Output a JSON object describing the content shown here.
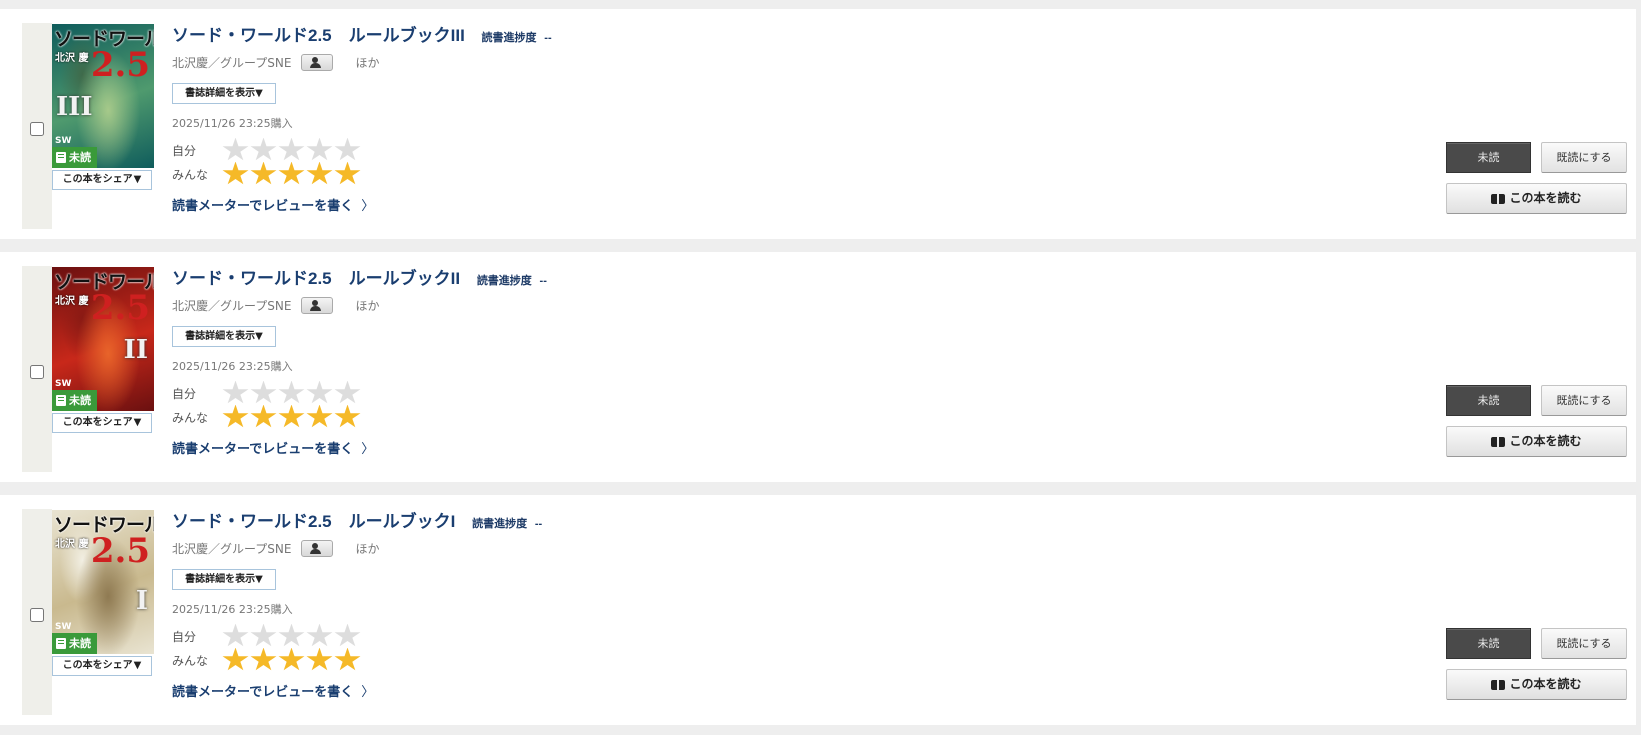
{
  "books": [
    {
      "title": "ソード・ワールド2.5　ルールブックIII",
      "progress_label": "読書進捗度",
      "progress_value": "--",
      "author": "北沢慶／グループSNE",
      "author_others": "ほか",
      "detail_button": "書誌詳細を表示▼",
      "purchase_date": "2025/11/26 23:25購入",
      "rating_mine_label": "自分",
      "rating_all_label": "みんな",
      "rating_mine": 0,
      "rating_all": 5,
      "review_link": "読書メーターでレビューを書く",
      "review_chevron": "〉",
      "status_button": "未読",
      "mark_read_button": "既読にする",
      "read_button": "この本を読む",
      "share_button": "この本をシェア",
      "share_caret": "▼",
      "cover": {
        "title": "ソードワールド",
        "author": "北沢 慶",
        "number": "2.5",
        "volume": "III",
        "logo": "SW",
        "badge": "未読",
        "art_colors": [
          "#0f5c5c",
          "#4f9a6e",
          "#a6c98a",
          "#3f6a4a"
        ]
      }
    },
    {
      "title": "ソード・ワールド2.5　ルールブックII",
      "progress_label": "読書進捗度",
      "progress_value": "--",
      "author": "北沢慶／グループSNE",
      "author_others": "ほか",
      "detail_button": "書誌詳細を表示▼",
      "purchase_date": "2025/11/26 23:25購入",
      "rating_mine_label": "自分",
      "rating_all_label": "みんな",
      "rating_mine": 0,
      "rating_all": 5,
      "review_link": "読書メーターでレビューを書く",
      "review_chevron": "〉",
      "status_button": "未読",
      "mark_read_button": "既読にする",
      "read_button": "この本を読む",
      "share_button": "この本をシェア",
      "share_caret": "▼",
      "cover": {
        "title": "ソードワールド",
        "author": "北沢 慶",
        "number": "2.5",
        "volume": "II",
        "logo": "SW",
        "badge": "未読",
        "art_colors": [
          "#6a1010",
          "#c8281a",
          "#e8642a",
          "#8a1a14"
        ]
      }
    },
    {
      "title": "ソード・ワールド2.5　ルールブックI",
      "progress_label": "読書進捗度",
      "progress_value": "--",
      "author": "北沢慶／グループSNE",
      "author_others": "ほか",
      "detail_button": "書誌詳細を表示▼",
      "purchase_date": "2025/11/26 23:25購入",
      "rating_mine_label": "自分",
      "rating_all_label": "みんな",
      "rating_mine": 0,
      "rating_all": 5,
      "review_link": "読書メーターでレビューを書く",
      "review_chevron": "〉",
      "status_button": "未読",
      "mark_read_button": "既読にする",
      "read_button": "この本を読む",
      "share_button": "この本をシェア",
      "share_caret": "▼",
      "cover": {
        "title": "ソードワールド",
        "author": "北沢 慶",
        "number": "2.5",
        "volume": "I",
        "logo": "SW",
        "badge": "未読",
        "art_colors": [
          "#e9e4d2",
          "#c9b98e",
          "#8f7a52",
          "#f2efe3"
        ]
      }
    }
  ]
}
